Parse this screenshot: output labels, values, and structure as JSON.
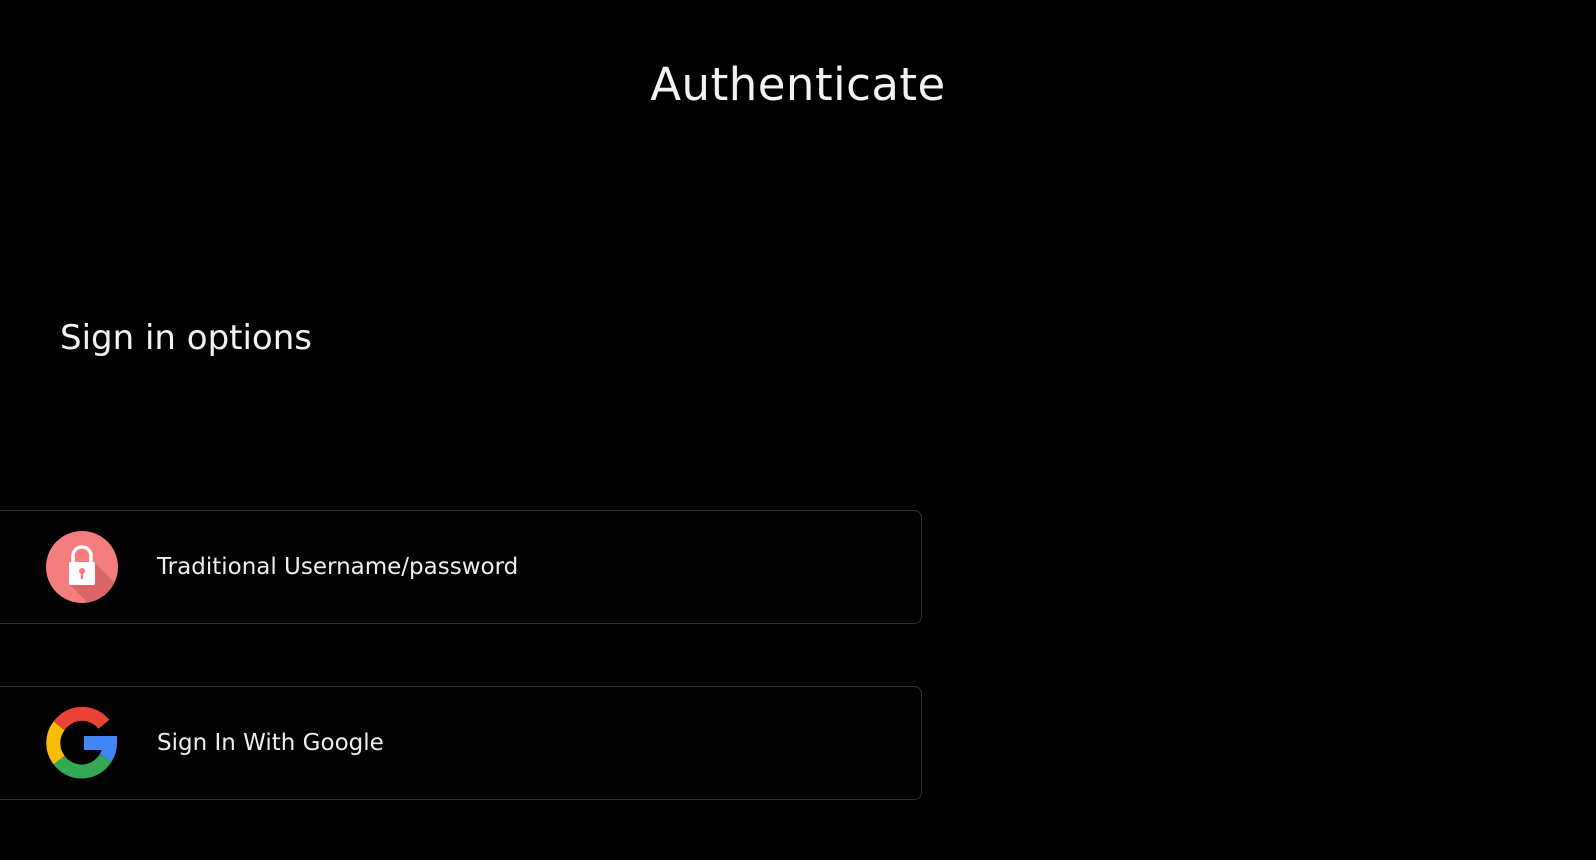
{
  "page": {
    "title": "Authenticate",
    "background": "#000000"
  },
  "signin": {
    "heading": "Sign in options",
    "options": [
      {
        "label": "Traditional Username/password",
        "icon": "lock-icon",
        "icon_color": "#F47E7E"
      },
      {
        "label": "Sign In With Google",
        "icon": "google-icon",
        "icon_colors": [
          "#EA4335",
          "#FBBC05",
          "#34A853",
          "#4285F4"
        ]
      }
    ]
  }
}
